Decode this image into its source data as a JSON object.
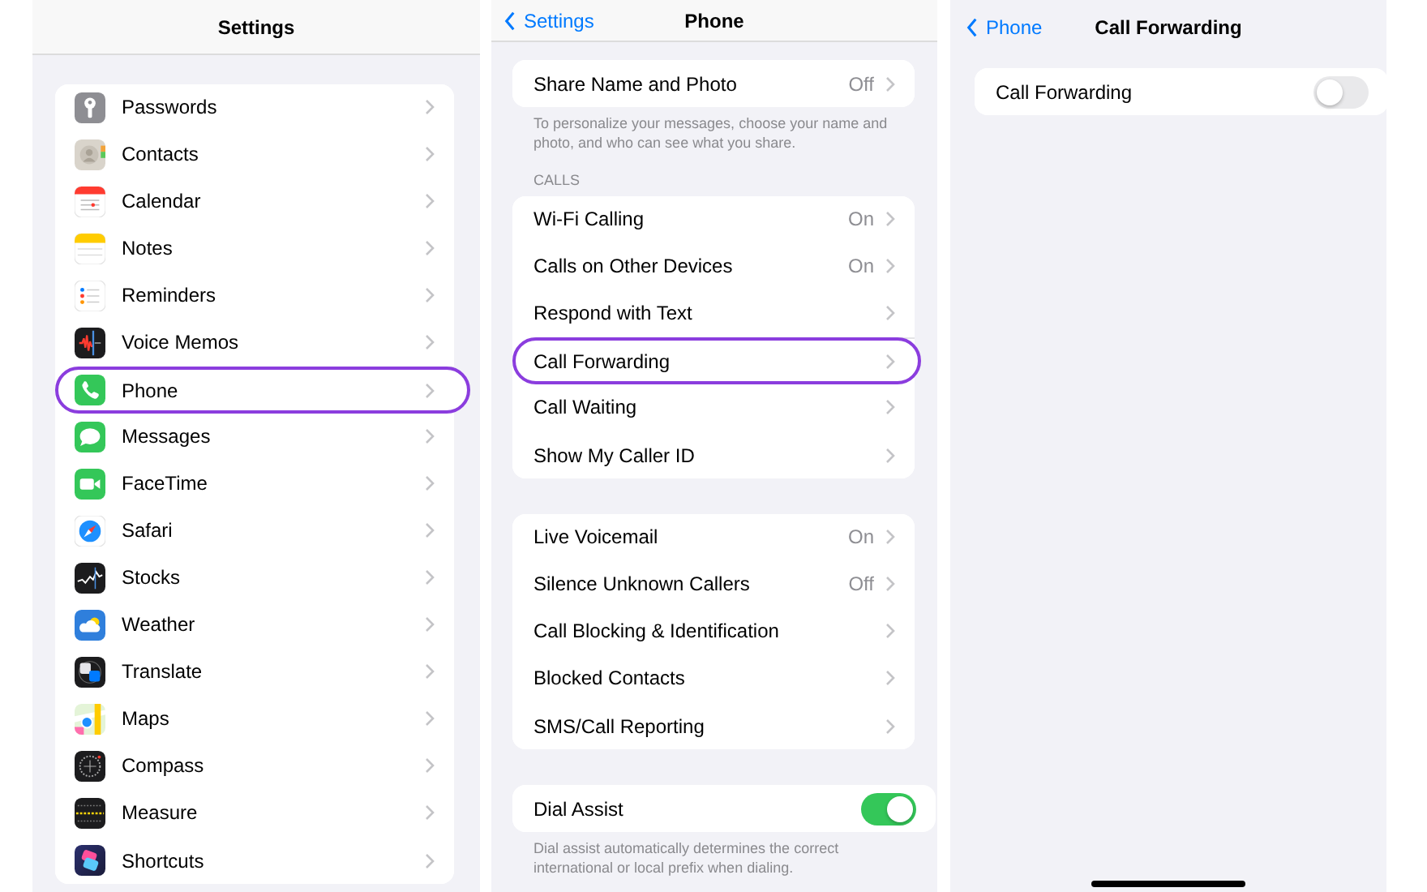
{
  "settings_screen": {
    "title": "Settings",
    "items": [
      {
        "label": "Passwords",
        "highlighted": false
      },
      {
        "label": "Contacts",
        "highlighted": false
      },
      {
        "label": "Calendar",
        "highlighted": false
      },
      {
        "label": "Notes",
        "highlighted": false
      },
      {
        "label": "Reminders",
        "highlighted": false
      },
      {
        "label": "Voice Memos",
        "highlighted": false
      },
      {
        "label": "Phone",
        "highlighted": true
      },
      {
        "label": "Messages",
        "highlighted": false
      },
      {
        "label": "FaceTime",
        "highlighted": false
      },
      {
        "label": "Safari",
        "highlighted": false
      },
      {
        "label": "Stocks",
        "highlighted": false
      },
      {
        "label": "Weather",
        "highlighted": false
      },
      {
        "label": "Translate",
        "highlighted": false
      },
      {
        "label": "Maps",
        "highlighted": false
      },
      {
        "label": "Compass",
        "highlighted": false
      },
      {
        "label": "Measure",
        "highlighted": false
      },
      {
        "label": "Shortcuts",
        "highlighted": false
      }
    ]
  },
  "phone_screen": {
    "back_button": "Settings",
    "title": "Phone",
    "groups": [
      {
        "rows": [
          {
            "kind": "link",
            "label": "Share Name and Photo",
            "value": "Off",
            "highlighted": false
          }
        ],
        "footer": "To personalize your messages, choose your name and photo, and who can see what you share."
      },
      {
        "header": "CALLS",
        "rows": [
          {
            "kind": "link",
            "label": "Wi-Fi Calling",
            "value": "On",
            "highlighted": false
          },
          {
            "kind": "link",
            "label": "Calls on Other Devices",
            "value": "On",
            "highlighted": false
          },
          {
            "kind": "link",
            "label": "Respond with Text",
            "highlighted": false
          },
          {
            "kind": "link",
            "label": "Call Forwarding",
            "highlighted": true
          },
          {
            "kind": "link",
            "label": "Call Waiting",
            "highlighted": false
          },
          {
            "kind": "link",
            "label": "Show My Caller ID",
            "highlighted": false
          }
        ]
      },
      {
        "rows": [
          {
            "kind": "link",
            "label": "Live Voicemail",
            "value": "On",
            "highlighted": false
          },
          {
            "kind": "link",
            "label": "Silence Unknown Callers",
            "value": "Off",
            "highlighted": false
          },
          {
            "kind": "link",
            "label": "Call Blocking & Identification",
            "highlighted": false
          },
          {
            "kind": "link",
            "label": "Blocked Contacts",
            "highlighted": false
          },
          {
            "kind": "link",
            "label": "SMS/Call Reporting",
            "highlighted": false
          }
        ]
      },
      {
        "rows": [
          {
            "kind": "toggle",
            "label": "Dial Assist",
            "on": true
          }
        ],
        "footer": "Dial assist automatically determines the correct international or local prefix when dialing."
      }
    ]
  },
  "call_forwarding_screen": {
    "back_button": "Phone",
    "title": "Call Forwarding",
    "rows": [
      {
        "kind": "toggle",
        "label": "Call Forwarding",
        "on": false
      }
    ]
  }
}
